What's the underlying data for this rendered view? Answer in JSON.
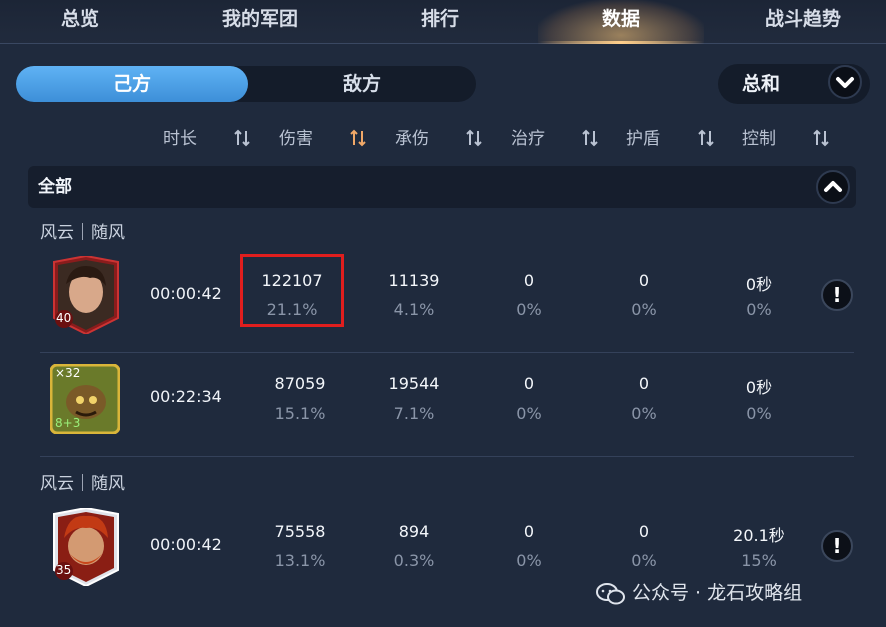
{
  "tabs": [
    "总览",
    "我的军团",
    "排行",
    "数据",
    "战斗趋势"
  ],
  "active_tab": "数据",
  "side": {
    "own": "己方",
    "enemy": "敌方"
  },
  "mode": {
    "label": "总和"
  },
  "columns": [
    "时长",
    "伤害",
    "承伤",
    "治疗",
    "护盾",
    "控制"
  ],
  "group": {
    "label": "全部"
  },
  "teams": [
    "风云｜随风",
    "风云｜随风"
  ],
  "rows": [
    {
      "level": "40",
      "time": "00:00:42",
      "damage": "122107",
      "damage_pct": "21.1%",
      "taken": "11139",
      "taken_pct": "4.1%",
      "heal": "0",
      "heal_pct": "0%",
      "shield": "0",
      "shield_pct": "0%",
      "control": "0秒",
      "control_pct": "0%"
    },
    {
      "badge_top": "×32",
      "badge_bottom": "8+3",
      "time": "00:22:34",
      "damage": "87059",
      "damage_pct": "15.1%",
      "taken": "19544",
      "taken_pct": "7.1%",
      "heal": "0",
      "heal_pct": "0%",
      "shield": "0",
      "shield_pct": "0%",
      "control": "0秒",
      "control_pct": "0%"
    },
    {
      "level": "35",
      "time": "00:00:42",
      "damage": "75558",
      "damage_pct": "13.1%",
      "taken": "894",
      "taken_pct": "0.3%",
      "heal": "0",
      "heal_pct": "0%",
      "shield": "0",
      "shield_pct": "0%",
      "control": "20.1秒",
      "control_pct": "15%"
    }
  ],
  "watermark": "公众号 · 龙石攻略组",
  "colors": {
    "background": "#1f2a3d",
    "accent_blue": "#4a9de6",
    "highlight_red": "#e01e1e",
    "sort_active": "#f0a868"
  }
}
